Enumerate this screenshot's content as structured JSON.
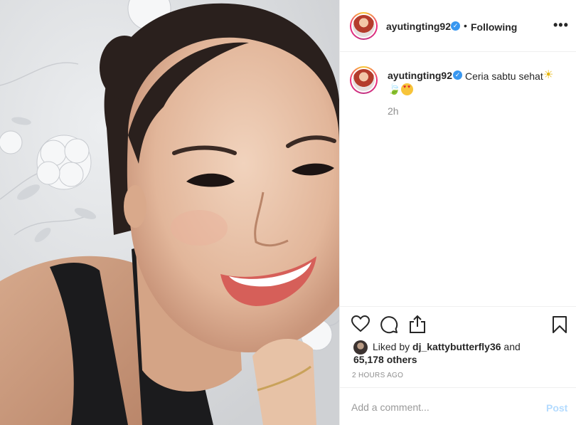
{
  "photo": {
    "alt": "post-photo"
  },
  "header": {
    "username": "ayutingting92",
    "verified_glyph": "✓",
    "separator": "•",
    "follow_status": "Following",
    "more_glyph": "•••"
  },
  "caption": {
    "username": "ayutingting92",
    "verified_glyph": "✓",
    "text": "Ceria sabtu sehat",
    "emoji_sun": "☀",
    "emoji_leaf": "🍃",
    "time": "2h"
  },
  "actions": {
    "icons": [
      "heart-icon",
      "comment-icon",
      "share-icon",
      "bookmark-icon"
    ]
  },
  "likes": {
    "prefix": "Liked by",
    "user": "dj_kattybutterfly36",
    "conj": "and",
    "count": "65,178 others"
  },
  "timestamp": "2 HOURS AGO",
  "comment": {
    "placeholder": "Add a comment...",
    "post_label": "Post"
  },
  "colors": {
    "verified": "#3897f0",
    "text": "#262626",
    "muted": "#8e8e8e",
    "post_disabled": "#b3dbff"
  }
}
